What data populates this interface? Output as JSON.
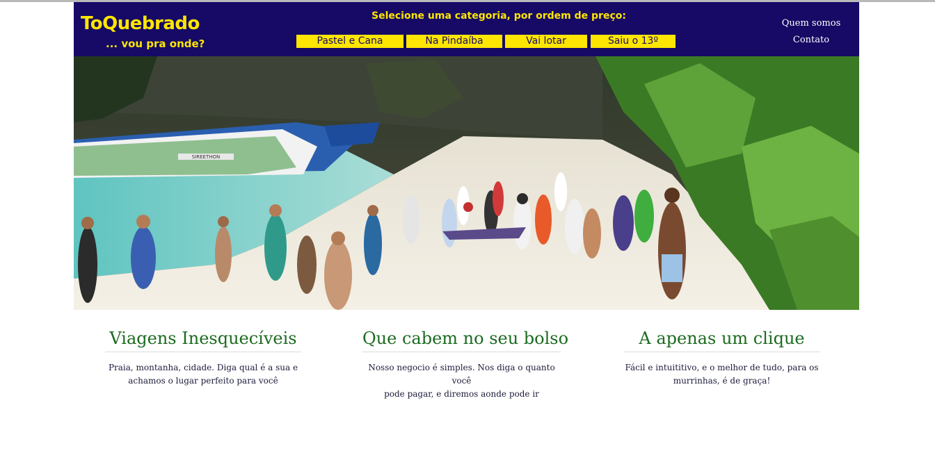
{
  "header": {
    "logo": "ToQuebrado",
    "tagline": "... vou pra onde?",
    "category_prompt": "Selecione uma categoria, por ordem de preço:",
    "categories": [
      "Pastel e Cana",
      "Na Pindaíba",
      "Vai lotar",
      "Saiu o 13º"
    ],
    "links": [
      "Quem somos",
      "Contato"
    ]
  },
  "hero": {
    "description_boat_name": "SIREETHON"
  },
  "features": [
    {
      "title": "Viagens Inesquecíveis",
      "line1": "Praia, montanha, cidade. Diga qual é a sua e",
      "line2": "achamos o lugar perfeito para você"
    },
    {
      "title": "Que cabem no seu bolso",
      "line1": "Nosso negocio é simples. Nos diga o quanto você",
      "line2": "pode pagar, e diremos aonde pode ir"
    },
    {
      "title": "A apenas um clique",
      "line1": "Fácil e intuititivo, e o melhor de tudo, para os",
      "line2": "murrinhas, é de graça!"
    }
  ],
  "colors": {
    "header_bg": "#160a66",
    "accent_yellow": "#ffe600",
    "heading_green": "#1b6b1f"
  }
}
